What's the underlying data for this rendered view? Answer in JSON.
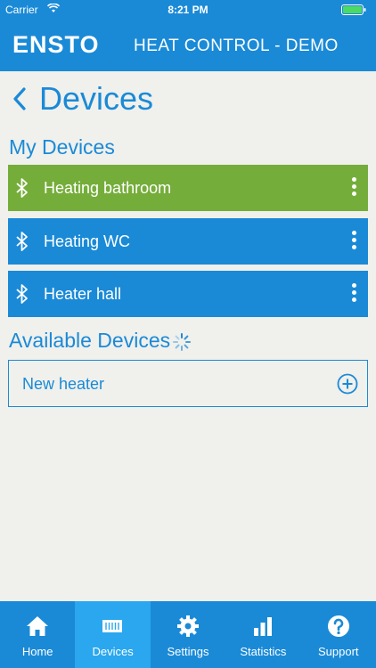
{
  "status": {
    "carrier": "Carrier",
    "time": "8:21 PM"
  },
  "app": {
    "logo": "ENSTO",
    "title": "HEAT CONTROL - DEMO"
  },
  "page": {
    "title": "Devices"
  },
  "my_devices": {
    "label": "My Devices",
    "items": [
      {
        "name": "Heating bathroom",
        "color": "#75ad3a"
      },
      {
        "name": "Heating WC",
        "color": "#1a8ad7"
      },
      {
        "name": "Heater hall",
        "color": "#1a8ad7"
      }
    ]
  },
  "available_devices": {
    "label": "Available Devices",
    "items": [
      {
        "name": "New heater"
      }
    ]
  },
  "tabs": [
    {
      "label": "Home",
      "icon": "home-icon"
    },
    {
      "label": "Devices",
      "icon": "devices-icon",
      "active": true
    },
    {
      "label": "Settings",
      "icon": "gear-icon"
    },
    {
      "label": "Statistics",
      "icon": "bar-chart-icon"
    },
    {
      "label": "Support",
      "icon": "help-icon"
    }
  ],
  "colors": {
    "primary": "#1a8ad7",
    "active_tab": "#2aa7ee",
    "selected_device": "#75ad3a",
    "background": "#f0f0ec"
  }
}
